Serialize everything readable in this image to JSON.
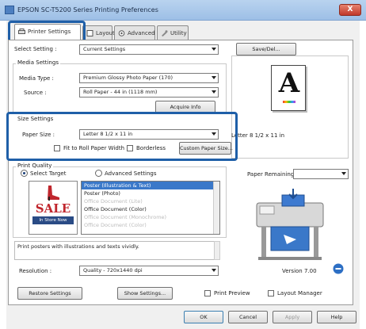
{
  "window": {
    "title": "EPSON SC-T5200 Series Printing Preferences",
    "close_label": "X"
  },
  "tabs": [
    {
      "label": "Printer Settings",
      "icon": "printer-icon"
    },
    {
      "label": "Layout",
      "icon": "layout-icon"
    },
    {
      "label": "Advanced",
      "icon": "advanced-icon"
    },
    {
      "label": "Utility",
      "icon": "utility-icon"
    }
  ],
  "select_setting": {
    "label": "Select Setting :",
    "value": "Current Settings",
    "save_button": "Save/Del..."
  },
  "media_settings": {
    "title": "Media Settings",
    "media_type_label": "Media Type :",
    "media_type_value": "Premium Glossy Photo Paper (170)",
    "source_label": "Source :",
    "source_value": "Roll Paper - 44 in (1118 mm)",
    "acquire_button": "Acquire Info"
  },
  "size_settings": {
    "title": "Size Settings",
    "paper_size_label": "Paper Size :",
    "paper_size_value": "Letter 8 1/2 x 11 in",
    "fit_roll_label": "Fit to Roll Paper Width",
    "borderless_label": "Borderless",
    "custom_button": "Custom Paper Size..."
  },
  "preview": {
    "letter": "A",
    "paper_text": "Letter 8 1/2 x 11 in"
  },
  "print_quality": {
    "title": "Print Quality",
    "select_target_label": "Select Target",
    "advanced_label": "Advanced Settings",
    "targets": [
      "Poster (Illustration & Text)",
      "Poster (Photo)",
      "Office Document (Lite)",
      "Office Document (Color)",
      "Office Document (Monochrome)",
      "Office Document (Color)"
    ],
    "thumb_sale": "SALE",
    "thumb_store": "In Store Now",
    "description": "Print posters with illustrations and texts vividly.",
    "resolution_label": "Resolution :",
    "resolution_value": "Quality - 720x1440 dpi"
  },
  "paper_remaining": {
    "label": "Paper Remaining :"
  },
  "version": "Version 7.00",
  "bottom": {
    "restore_button": "Restore Settings",
    "show_settings_button": "Show Settings...",
    "print_preview_label": "Print Preview",
    "layout_manager_label": "Layout Manager"
  },
  "footer": {
    "ok": "OK",
    "cancel": "Cancel",
    "apply": "Apply",
    "help": "Help"
  },
  "colors": {
    "accent": "#1f5fa8",
    "selection": "#3a78c9",
    "sale_red": "#c0262d"
  }
}
